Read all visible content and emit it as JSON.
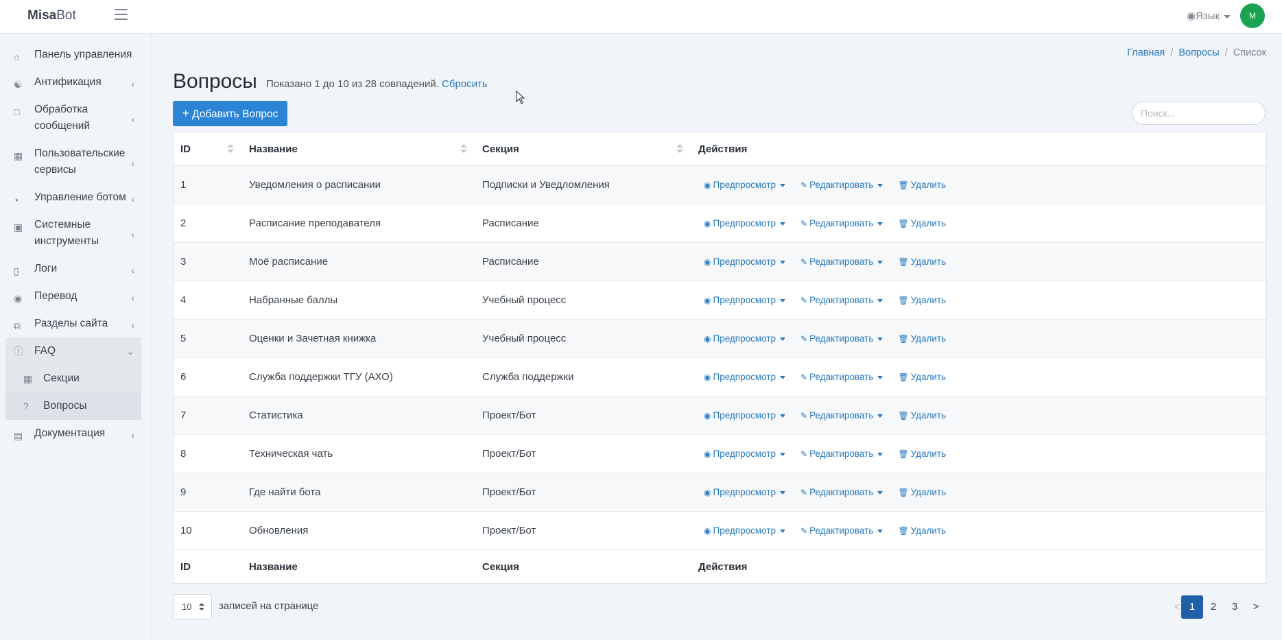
{
  "header": {
    "brand_bold": "Misa",
    "brand_rest": "Bot",
    "language_label": "Язык",
    "avatar_initial": "M"
  },
  "sidebar": {
    "items": [
      {
        "label": "Панель управления",
        "icon": "home-icon"
      },
      {
        "label": "Антификация",
        "icon": "users-icon"
      },
      {
        "label": "Обработка сообщений",
        "icon": "chat-icon"
      },
      {
        "label": "Пользовательские сервисы",
        "icon": "grid-icon"
      },
      {
        "label": "Управление ботом",
        "icon": "network-icon"
      },
      {
        "label": "Системные инструменты",
        "icon": "briefcase-icon"
      },
      {
        "label": "Логи",
        "icon": "scroll-icon"
      },
      {
        "label": "Перевод",
        "icon": "globe-icon"
      },
      {
        "label": "Разделы сайта",
        "icon": "copy-icon"
      },
      {
        "label": "FAQ",
        "icon": "question-circle-icon"
      },
      {
        "label": "Документация",
        "icon": "book-icon"
      }
    ],
    "sub_items": [
      {
        "label": "Секции",
        "icon": "table-icon"
      },
      {
        "label": "Вопросы",
        "icon": "question-mark-icon"
      }
    ]
  },
  "breadcrumb": [
    "Главная",
    "Вопросы",
    "Список"
  ],
  "page": {
    "title": "Вопросы",
    "subtitle": "Показано 1 до 10 из 28 совпадений.",
    "reset_link": "Сбросить",
    "add_button": "Добавить Вопрос",
    "search_placeholder": "Поиск..."
  },
  "table": {
    "columns": [
      "ID",
      "Название",
      "Секция",
      "Действия"
    ],
    "rows": [
      {
        "id": "1",
        "name": "Уведомления о расписании",
        "section": "Подписки и Уведломления"
      },
      {
        "id": "2",
        "name": "Расписание преподавателя",
        "section": "Расписание"
      },
      {
        "id": "3",
        "name": "Моё расписание",
        "section": "Расписание"
      },
      {
        "id": "4",
        "name": "Набранные баллы",
        "section": "Учебный процесс"
      },
      {
        "id": "5",
        "name": "Оценки и Зачетная книжка",
        "section": "Учебный процесс"
      },
      {
        "id": "6",
        "name": "Служба поддержки ТГУ (АХО)",
        "section": "Служба поддержки"
      },
      {
        "id": "7",
        "name": "Статистика",
        "section": "Проект/Бот"
      },
      {
        "id": "8",
        "name": "Техническая чать",
        "section": "Проект/Бот"
      },
      {
        "id": "9",
        "name": "Где найти бота",
        "section": "Проект/Бот"
      },
      {
        "id": "10",
        "name": "Обновления",
        "section": "Проект/Бот"
      }
    ],
    "actions": {
      "preview": "Предпросмотр",
      "edit": "Редактировать",
      "delete": "Удалить"
    }
  },
  "footer": {
    "per_page_value": "10",
    "per_page_label": "записей на странице",
    "pagination": {
      "prev": "<",
      "pages": [
        "1",
        "2",
        "3"
      ],
      "next": ">",
      "current": "1"
    }
  }
}
